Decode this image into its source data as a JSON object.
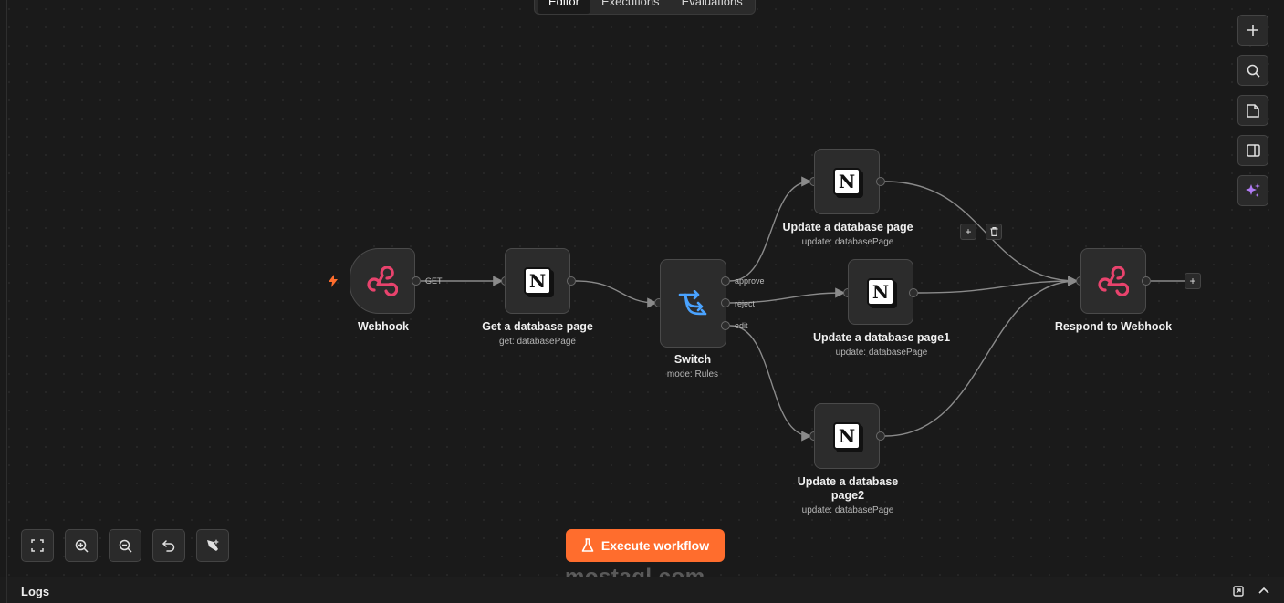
{
  "tabs": [
    "Editor",
    "Executions",
    "Evaluations"
  ],
  "nodes": {
    "webhook": {
      "title": "Webhook",
      "icon": "webhook-icon"
    },
    "get_page": {
      "title": "Get a database page",
      "subtitle": "get: databasePage",
      "icon": "notion-icon"
    },
    "switch": {
      "title": "Switch",
      "subtitle": "mode: Rules",
      "icon": "switch-icon",
      "outputs": [
        "approve",
        "reject",
        "edit"
      ]
    },
    "update_page": {
      "title": "Update a database page",
      "subtitle": "update: databasePage",
      "icon": "notion-icon"
    },
    "update_page1": {
      "title": "Update a database page1",
      "subtitle": "update: databasePage",
      "icon": "notion-icon"
    },
    "update_page2": {
      "title": "Update a database page2",
      "subtitle": "update: databasePage",
      "icon": "notion-icon"
    },
    "respond": {
      "title": "Respond to Webhook",
      "icon": "webhook-icon"
    }
  },
  "edge_labels": {
    "webhook_out": "GET"
  },
  "execute_button": {
    "label": "Execute workflow"
  },
  "logs": {
    "label": "Logs"
  },
  "watermark": "mostaql.com",
  "colors": {
    "accent": "#ff6d2d",
    "webhook": "#e8436d",
    "switch": "#4aa3ff",
    "ai": "#b27cf5"
  }
}
